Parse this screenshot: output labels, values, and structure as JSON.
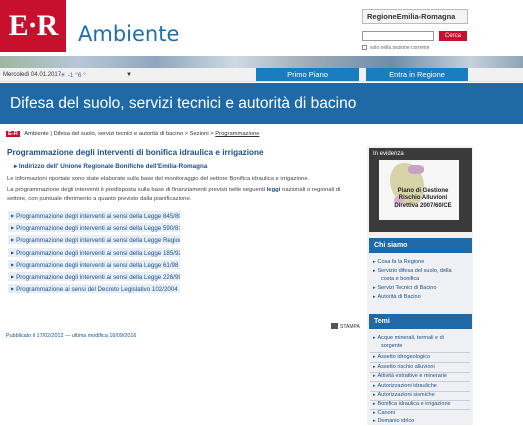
{
  "header": {
    "logo_text": "E·R",
    "brand": "Ambiente",
    "regione_label": "RegioneEmilia-Romagna",
    "search": {
      "placeholder": "",
      "button_label": "Cerca",
      "option_label": "solo nella sezione corrente"
    }
  },
  "datebar": {
    "date": "Mercoledì 04.01.2017",
    "weather": "-1 °6 °"
  },
  "tabs": [
    {
      "label": "Primo Piano"
    },
    {
      "label": "Entra in Regione"
    }
  ],
  "section_title": "Difesa del suolo, servizi tecnici e autorità di bacino",
  "breadcrumb": {
    "badge": "E-R",
    "items": [
      "Ambiente",
      "Difesa del suolo, servizi tecnici e autorità di bacino",
      "Sezioni",
      "Programmazione"
    ]
  },
  "main": {
    "title": "Programmazione degli interventi di bonifica idraulica e irrigazione",
    "subtitle": "Indirizzo dell' Unione Regionale Bonifiche dell'Emilia-Romagna",
    "paragraph1": "Le informazioni riportate sono state elaborate sulla base del monitoraggio del settore Bonifica idraulica e irrigazione.",
    "paragraph2_a": "La programmazione degli interventi è predisposta sulla base di finanziamenti previsti nelle seguenti",
    "paragraph2_b": "leggi",
    "paragraph2_c": "nazionali o regionali di settore, con puntuale riferimento a quanto previsto dalla pianificazione.",
    "links": [
      {
        "label": "Programmazione degli interventi ai sensi della Legge 845/80"
      },
      {
        "label": "Programmazione degli interventi ai sensi della Legge 590/81"
      },
      {
        "label": "Programmazione degli interventi ai sensi della Legge Regionale 42/84"
      },
      {
        "label": "Programmazione degli interventi ai sensi della Legge 185/92"
      },
      {
        "label": "Programmazione degli interventi ai sensi della Legge 61/98"
      },
      {
        "label": "Programmazione degli interventi ai sensi della Legge 226/99"
      },
      {
        "label": "Programmazione ai sensi del Decreto Legislativo 102/2004"
      }
    ],
    "stampa": "STAMPA",
    "published": "Pubblicato il 17/02/2012 — ultima modifica 16/09/2016"
  },
  "sidebar": {
    "evidenza_title": "In evidenza",
    "evidenza_caption": [
      "Piano di Gestione",
      "Rischio Alluvioni",
      "Direttiva 2007/60/CE"
    ],
    "chi_siamo_title": "Chi siamo",
    "chi_siamo_items": [
      {
        "label": "Cosa fa la Regione"
      },
      {
        "label": "Servizio difesa del suolo, della"
      },
      {
        "label": "costa e bonifica"
      },
      {
        "label": "Servizi Tecnici di Bacino"
      },
      {
        "label": "Autorità di Bacino"
      }
    ],
    "temi_title": "Temi",
    "temi_items": [
      {
        "label": "Acque minerali, termali e di"
      },
      {
        "label": "sorgente"
      },
      {
        "label": "Assetto idrogeologico"
      },
      {
        "label": "Assetto rischio alluvioni"
      },
      {
        "label": "Attività estrattive e minerarie"
      },
      {
        "label": "Autorizzazioni idrauliche"
      },
      {
        "label": "Autorizzazioni sismiche"
      },
      {
        "label": "Bonifica idraulica e irrigazione"
      },
      {
        "label": "Canoni"
      },
      {
        "label": "Demanio idrico"
      }
    ]
  }
}
